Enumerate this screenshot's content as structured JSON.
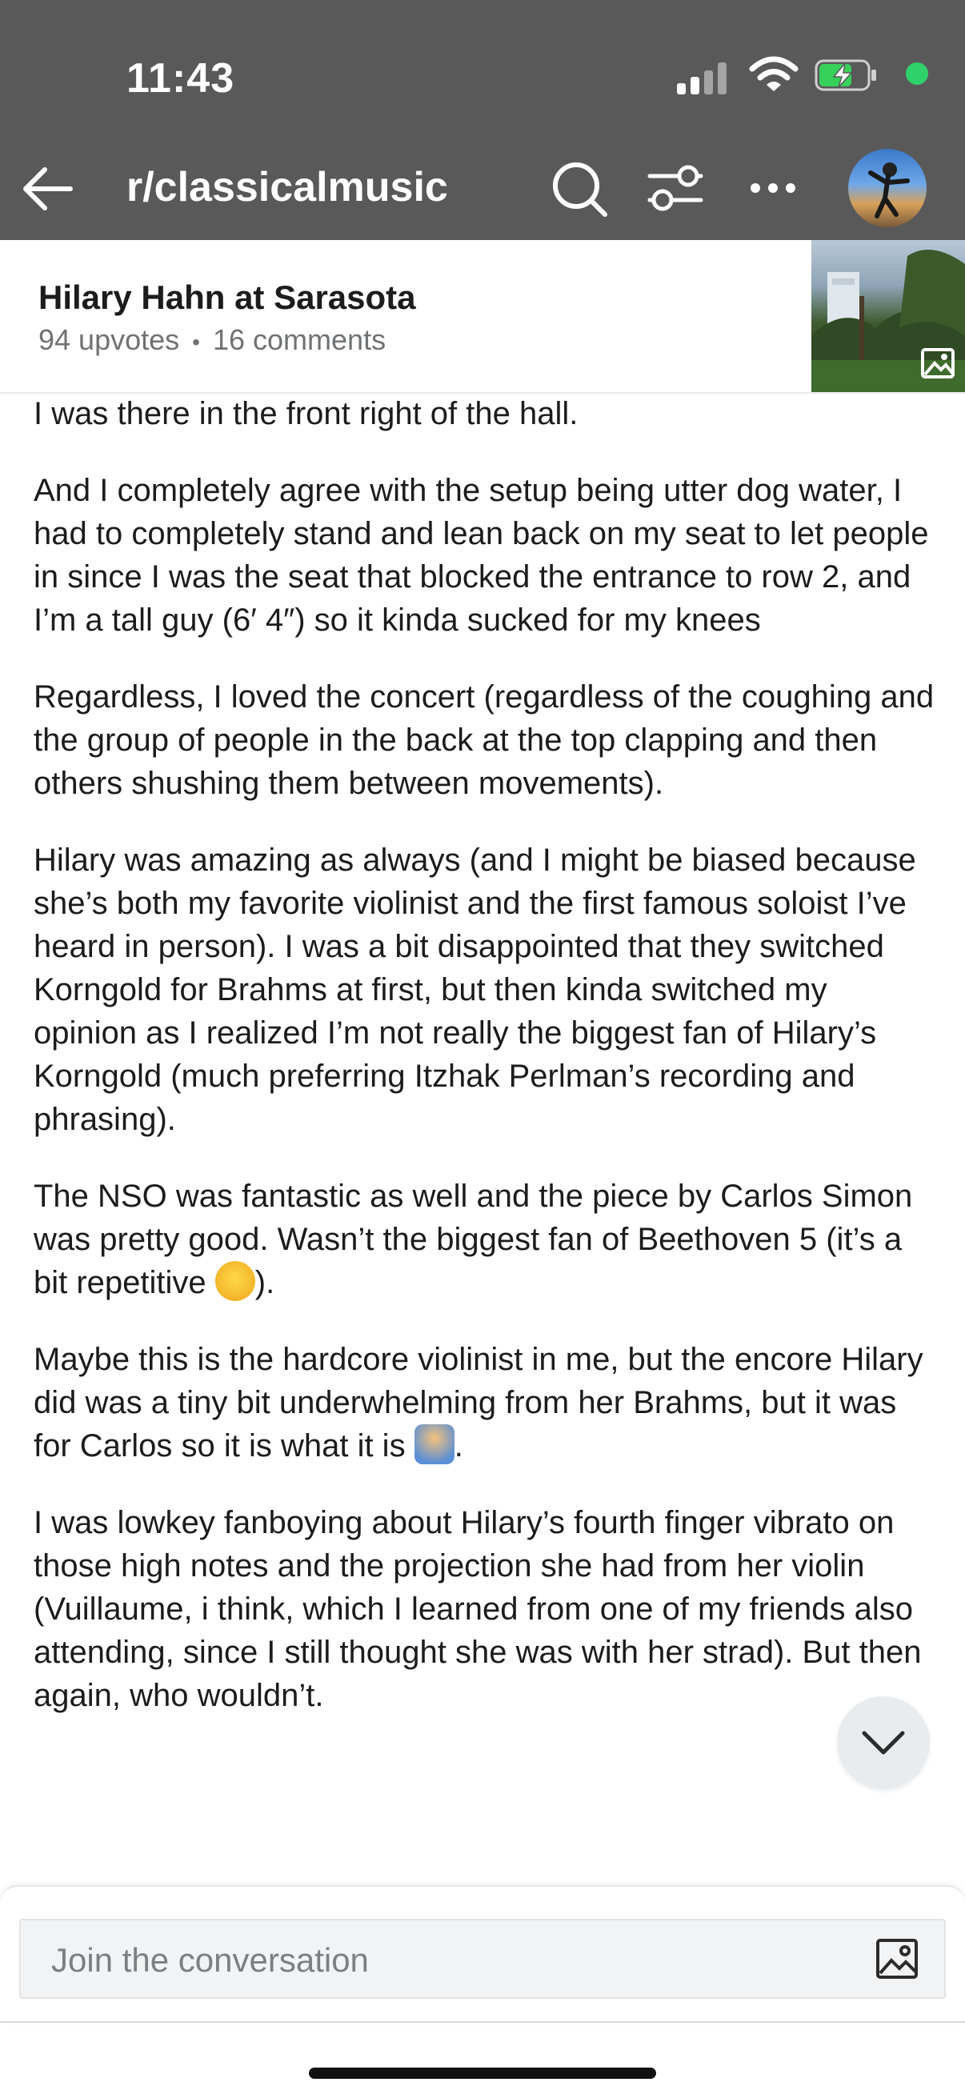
{
  "status_bar": {
    "time": "11:43"
  },
  "header": {
    "subreddit": "r/classicalmusic"
  },
  "post": {
    "title": "Hilary Hahn at Sarasota",
    "upvotes": "94 upvotes",
    "separator": "•",
    "comments": "16 comments"
  },
  "comment": {
    "paragraphs": [
      "I was there in the front right of the hall.",
      "And I completely agree with the setup being utter dog water, I had to completely stand and lean back on my seat to let people in since I was the seat that blocked the entrance to row 2, and I’m a tall guy (6′ 4″) so it kinda sucked for my knees",
      "Regardless, I loved the concert (regardless of the coughing and the group of people in the back at the top clapping and then others shushing them between movements).",
      "Hilary was amazing as always (and I might be biased because she’s both my favorite violinist and the first famous soloist I’ve heard in person). I was a bit disappointed that they switched Korngold for Brahms at first, but then kinda switched my opinion as I realized I’m not really the biggest fan of Hilary’s Korngold (much preferring Itzhak Perlman’s recording and phrasing).",
      "The NSO was fantastic as well and the piece by Carlos Simon was pretty good. Wasn’t the biggest fan of Beethoven 5 (it’s a bit repetitive",
      ").",
      "Maybe this is the hardcore violinist in me, but the encore Hilary did was a tiny bit underwhelming from her Brahms, but it was for Carlos so it is what it is",
      ".",
      "I was lowkey fanboying about Hilary’s fourth finger vibrato on those high notes and the projection she had from her violin (Vuillaume, i think, which I learned from one of my friends also attending, since I still thought she was with her strad). But then again, who wouldn’t."
    ]
  },
  "composer": {
    "placeholder": "Join the conversation"
  },
  "icons": {
    "back": "arrow-left-icon",
    "search": "search-icon",
    "filter": "filter-icon",
    "more": "more-horizontal-icon",
    "image": "image-icon",
    "scroll": "chevron-down-icon",
    "emoji_1": "grinning-sweat-emoji",
    "emoji_2": "person-shrugging-emoji"
  },
  "colors": {
    "header_bg": "#595959",
    "online_dot": "#2fd26a",
    "text": "#1c1c1c",
    "meta": "#6f7274"
  }
}
